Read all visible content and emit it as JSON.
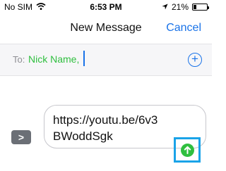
{
  "status_bar": {
    "carrier": "No SIM",
    "wifi_icon": "wifi-icon",
    "time": "6:53 PM",
    "location_icon": "location-arrow-icon",
    "battery_percent": "21%",
    "battery_level": 0.21
  },
  "nav": {
    "title": "New Message",
    "cancel_label": "Cancel"
  },
  "to_field": {
    "label": "To:",
    "recipient": "Nick Name,",
    "add_icon": "plus-circle-icon"
  },
  "composer": {
    "expand_icon": "chevron-right-icon",
    "expand_glyph": ">",
    "message_text": "https://youtu.be/6v3BWoddSgk",
    "send_icon": "arrow-up-icon"
  },
  "colors": {
    "accent_blue": "#1a73e8",
    "recipient_green": "#2fbf3f",
    "send_green": "#2fbf3f",
    "highlight_blue": "#1aa3e8"
  }
}
